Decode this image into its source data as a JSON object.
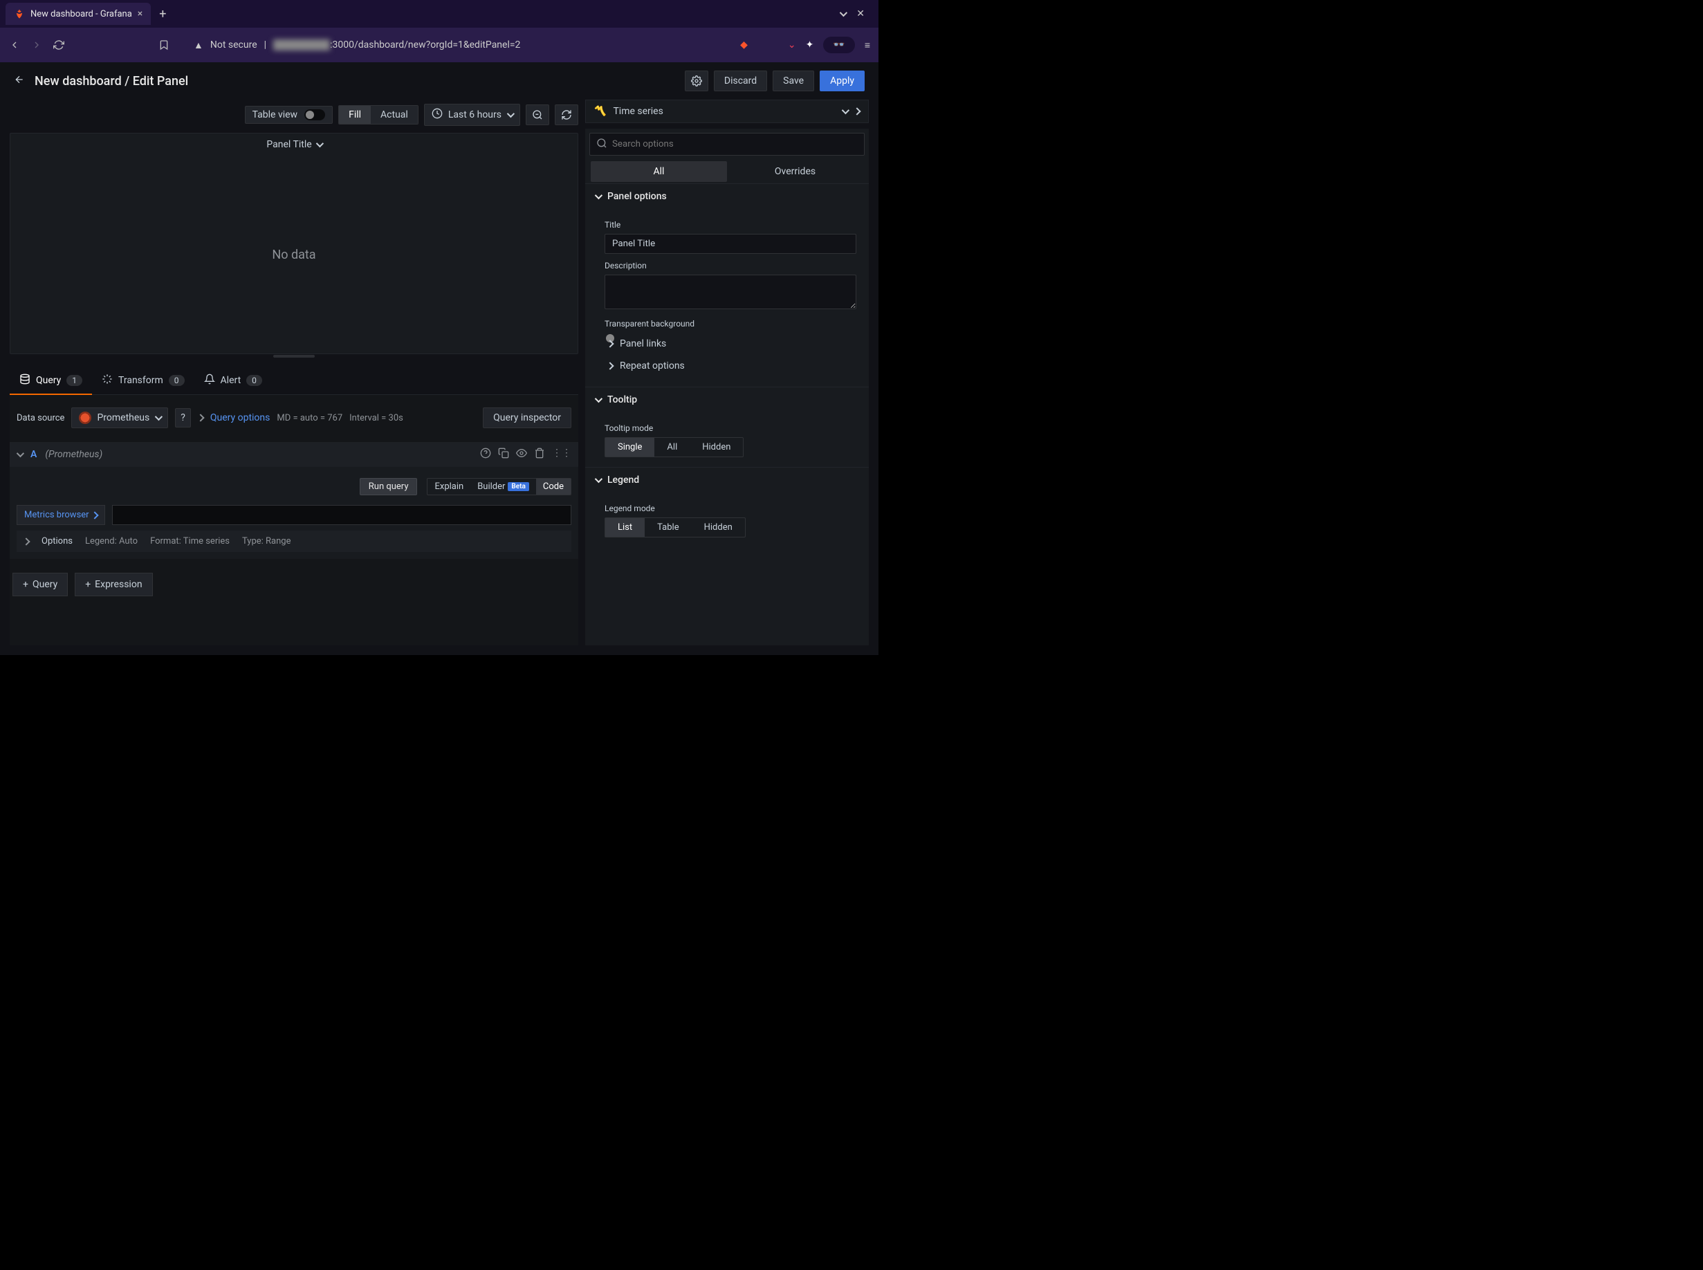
{
  "browser": {
    "tab_title": "New dashboard - Grafana",
    "url_prefix": "Not secure",
    "url_host_hidden": "hidden",
    "url_path": ":3000/dashboard/new?orgId=1&editPanel=2"
  },
  "header": {
    "breadcrumb": "New dashboard / Edit Panel",
    "discard": "Discard",
    "save": "Save",
    "apply": "Apply"
  },
  "viz_toolbar": {
    "table_view": "Table view",
    "fill": "Fill",
    "actual": "Actual",
    "time_range": "Last 6 hours"
  },
  "panel": {
    "title": "Panel Title",
    "empty": "No data"
  },
  "tabs": {
    "query": "Query",
    "query_count": "1",
    "transform": "Transform",
    "transform_count": "0",
    "alert": "Alert",
    "alert_count": "0"
  },
  "datasource": {
    "label": "Data source",
    "name": "Prometheus",
    "query_options": "Query options",
    "md": "MD = auto = 767",
    "interval": "Interval = 30s",
    "inspector": "Query inspector"
  },
  "query_row": {
    "letter": "A",
    "source": "(Prometheus)",
    "run": "Run query",
    "explain": "Explain",
    "builder": "Builder",
    "beta": "Beta",
    "code": "Code",
    "metrics_browser": "Metrics browser",
    "options": "Options",
    "legend": "Legend: Auto",
    "format": "Format: Time series",
    "type": "Type: Range"
  },
  "add": {
    "query": "Query",
    "expression": "Expression"
  },
  "sidebar": {
    "viz_type": "Time series",
    "search_placeholder": "Search options",
    "tab_all": "All",
    "tab_overrides": "Overrides",
    "panel_options": {
      "header": "Panel options",
      "title_label": "Title",
      "title_value": "Panel Title",
      "desc_label": "Description",
      "transparent": "Transparent background",
      "links": "Panel links",
      "repeat": "Repeat options"
    },
    "tooltip": {
      "header": "Tooltip",
      "mode_label": "Tooltip mode",
      "single": "Single",
      "all": "All",
      "hidden": "Hidden"
    },
    "legend": {
      "header": "Legend",
      "mode_label": "Legend mode",
      "list": "List",
      "table": "Table",
      "hidden": "Hidden"
    }
  }
}
